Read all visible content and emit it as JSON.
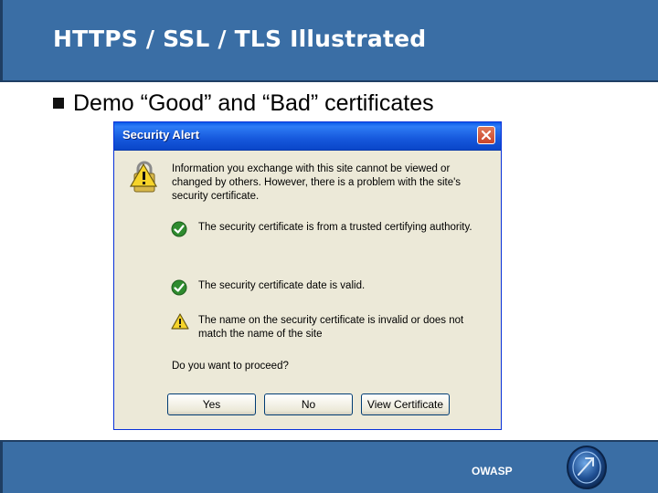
{
  "slide": {
    "title": "HTTPS / SSL / TLS Illustrated",
    "bullet": "Demo “Good” and “Bad” certificates",
    "footer": "OWASP"
  },
  "dialog": {
    "title": "Security Alert",
    "info": "Information you exchange with this site cannot be viewed or changed by others. However, there is a problem with the site's security certificate.",
    "rows": [
      {
        "icon": "check-icon",
        "text": "The security certificate is from a trusted certifying authority."
      },
      {
        "icon": "check-icon",
        "text": "The security certificate date is valid."
      },
      {
        "icon": "warning-icon",
        "text": "The name on the security certificate is invalid or does not match the name of the site"
      }
    ],
    "question": "Do you want to proceed?",
    "buttons": {
      "yes": "Yes",
      "no": "No",
      "view": "View Certificate"
    }
  },
  "colors": {
    "slide_band": "#3a6ea5",
    "titlebar": "#0a5ae8",
    "dialog_bg": "#ece9d8",
    "ok_green": "#2e8b2e",
    "warn_yellow": "#f2d21b"
  }
}
